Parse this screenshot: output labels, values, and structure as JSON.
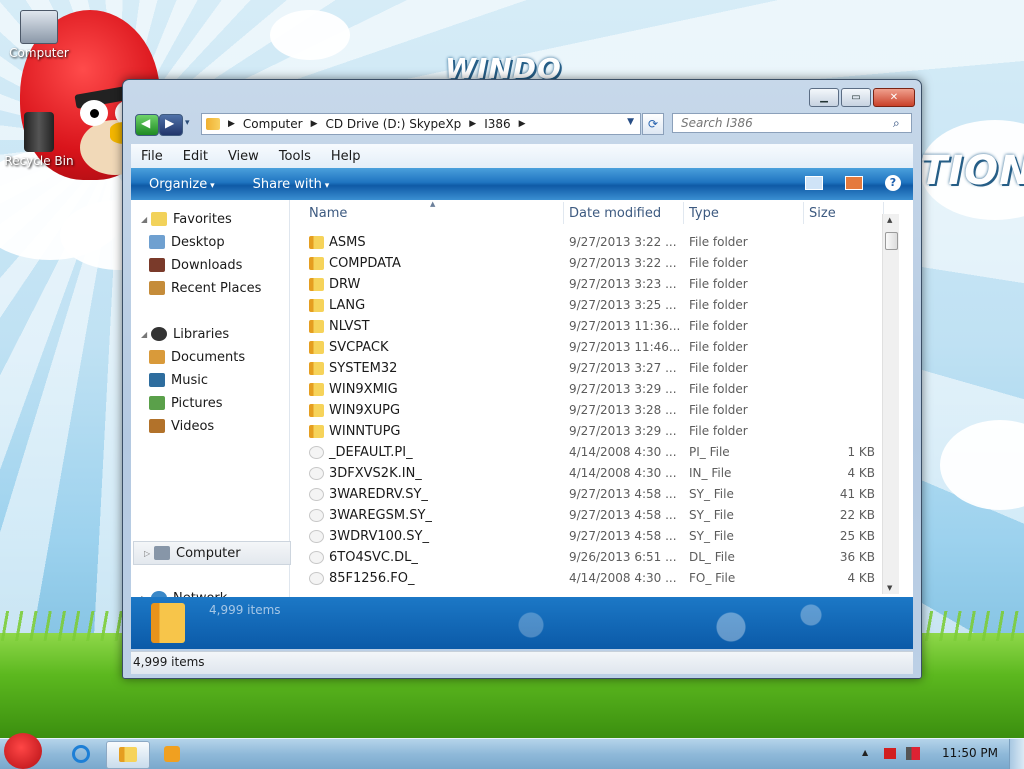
{
  "desktop": {
    "icons": [
      {
        "label": "Computer"
      },
      {
        "label": "Recycle Bin"
      }
    ]
  },
  "window": {
    "nav": {
      "back_label": "◀",
      "forward_label": "▶",
      "history_label": "▾",
      "address_segments": [
        "Computer",
        "CD Drive (D:) SkypeXp",
        "I386"
      ],
      "search_placeholder": "Search I386",
      "refresh_label": "⟳",
      "search_icon": "⌕"
    },
    "menu": [
      "File",
      "Edit",
      "View",
      "Tools",
      "Help"
    ],
    "commands": [
      "Organize",
      "Share with"
    ],
    "help_label": "?",
    "navigation": {
      "favorites": {
        "label": "Favorites",
        "items": [
          "Desktop",
          "Downloads",
          "Recent Places"
        ]
      },
      "libraries": {
        "label": "Libraries",
        "items": [
          "Documents",
          "Music",
          "Pictures",
          "Videos"
        ]
      },
      "computer": "Computer",
      "network": "Network"
    },
    "columns": {
      "name": "Name",
      "date": "Date modified",
      "type": "Type",
      "size": "Size"
    },
    "files": [
      {
        "name": "ASMS",
        "date": "9/27/2013 3:22 ...",
        "type": "File folder",
        "size": "",
        "kind": "folder"
      },
      {
        "name": "COMPDATA",
        "date": "9/27/2013 3:22 ...",
        "type": "File folder",
        "size": "",
        "kind": "folder"
      },
      {
        "name": "DRW",
        "date": "9/27/2013 3:23 ...",
        "type": "File folder",
        "size": "",
        "kind": "folder"
      },
      {
        "name": "LANG",
        "date": "9/27/2013 3:25 ...",
        "type": "File folder",
        "size": "",
        "kind": "folder"
      },
      {
        "name": "NLVST",
        "date": "9/27/2013 11:36...",
        "type": "File folder",
        "size": "",
        "kind": "folder"
      },
      {
        "name": "SVCPACK",
        "date": "9/27/2013 11:46...",
        "type": "File folder",
        "size": "",
        "kind": "folder"
      },
      {
        "name": "SYSTEM32",
        "date": "9/27/2013 3:27 ...",
        "type": "File folder",
        "size": "",
        "kind": "folder"
      },
      {
        "name": "WIN9XMIG",
        "date": "9/27/2013 3:29 ...",
        "type": "File folder",
        "size": "",
        "kind": "folder"
      },
      {
        "name": "WIN9XUPG",
        "date": "9/27/2013 3:28 ...",
        "type": "File folder",
        "size": "",
        "kind": "folder"
      },
      {
        "name": "WINNTUPG",
        "date": "9/27/2013 3:29 ...",
        "type": "File folder",
        "size": "",
        "kind": "folder"
      },
      {
        "name": "_DEFAULT.PI_",
        "date": "4/14/2008 4:30 ...",
        "type": "PI_ File",
        "size": "1 KB",
        "kind": "file"
      },
      {
        "name": "3DFXVS2K.IN_",
        "date": "4/14/2008 4:30 ...",
        "type": "IN_ File",
        "size": "4 KB",
        "kind": "file"
      },
      {
        "name": "3WAREDRV.SY_",
        "date": "9/27/2013 4:58 ...",
        "type": "SY_ File",
        "size": "41 KB",
        "kind": "file"
      },
      {
        "name": "3WAREGSM.SY_",
        "date": "9/27/2013 4:58 ...",
        "type": "SY_ File",
        "size": "22 KB",
        "kind": "file"
      },
      {
        "name": "3WDRV100.SY_",
        "date": "9/27/2013 4:58 ...",
        "type": "SY_ File",
        "size": "25 KB",
        "kind": "file"
      },
      {
        "name": "6TO4SVC.DL_",
        "date": "9/26/2013 6:51 ...",
        "type": "DL_ File",
        "size": "36 KB",
        "kind": "file"
      },
      {
        "name": "85F1256.FO_",
        "date": "4/14/2008 4:30 ...",
        "type": "FO_ File",
        "size": "4 KB",
        "kind": "file"
      }
    ],
    "details_count": "4,999 items",
    "status_text": "4,999 items"
  },
  "taskbar": {
    "clock": "11:50 PM",
    "tray_overflow_label": "▲"
  },
  "colors": {
    "command_bar": "#1f74c0",
    "accent": "#0b5aa8",
    "folder": "#f0b030"
  }
}
